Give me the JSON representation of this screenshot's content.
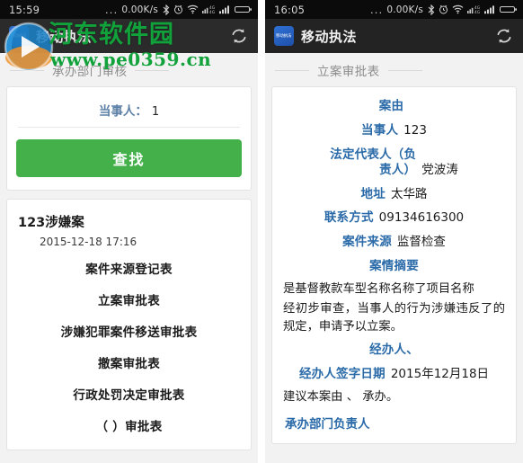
{
  "watermark": {
    "text_cn": "河东软件园",
    "url": "www.pe0359.cn",
    "logo_icon": "globe-logo-icon"
  },
  "left_phone": {
    "status_bar": {
      "clock": "15:59",
      "dots": "...",
      "net_speed": "0.00K/s",
      "icons": [
        "bluetooth-icon",
        "alarm-icon",
        "wifi-icon",
        "dual-sim-4g-icon",
        "signal-icon",
        "battery-icon"
      ]
    },
    "title_bar": {
      "app_name": "移动执法",
      "app_icon_label": "移动执法",
      "refresh_icon": "refresh-icon"
    },
    "section_header": "承办部门审核",
    "search_card": {
      "field_label": "当事人：",
      "field_value": "1",
      "find_button": "查找"
    },
    "case_card": {
      "title": "123涉嫌案",
      "date": "2015-12-18 17:16",
      "items": [
        "案件来源登记表",
        "立案审批表",
        "涉嫌犯罪案件移送审批表",
        "撤案审批表",
        "行政处罚决定审批表",
        "（ ）审批表"
      ]
    }
  },
  "right_phone": {
    "status_bar": {
      "clock": "16:05",
      "dots": "...",
      "net_speed": "0.00K/s",
      "icons": [
        "bluetooth-icon",
        "alarm-icon",
        "wifi-icon",
        "dual-sim-4g-icon",
        "signal-icon",
        "battery-icon"
      ]
    },
    "title_bar": {
      "app_name": "移动执法",
      "app_icon_label": "移动执法",
      "refresh_icon": "refresh-icon"
    },
    "section_header": "立案审批表",
    "detail": {
      "rows": [
        {
          "label": "案由",
          "value": ""
        },
        {
          "label": "当事人",
          "value": "123"
        },
        {
          "label": "法定代表人（负\n责人）",
          "value": "党波涛"
        },
        {
          "label": "地址",
          "value": "太华路"
        },
        {
          "label": "联系方式",
          "value": "09134616300"
        },
        {
          "label": "案件来源",
          "value": "监督检查"
        }
      ],
      "summary_label": "案情摘要",
      "summary_line1": "是基督教款车型名称名称了项目名称",
      "summary_line2": "经初步审查，当事人的行为涉嫌违反了的规定，申请予以立案。",
      "handler_label": "经办人、",
      "sign_date_label": "经办人签字日期",
      "sign_date_value": "2015年12月18日",
      "suggestion": "建议本案由 、 承办。",
      "dept_head_label": "承办部门负责人"
    }
  },
  "colors": {
    "accent_green": "#43b04a",
    "label_blue": "#2a6aa8",
    "statusbar_bg": "#0b0b0b",
    "titlebar_bg": "#2b2b2b",
    "page_bg": "#f2f2f2"
  }
}
